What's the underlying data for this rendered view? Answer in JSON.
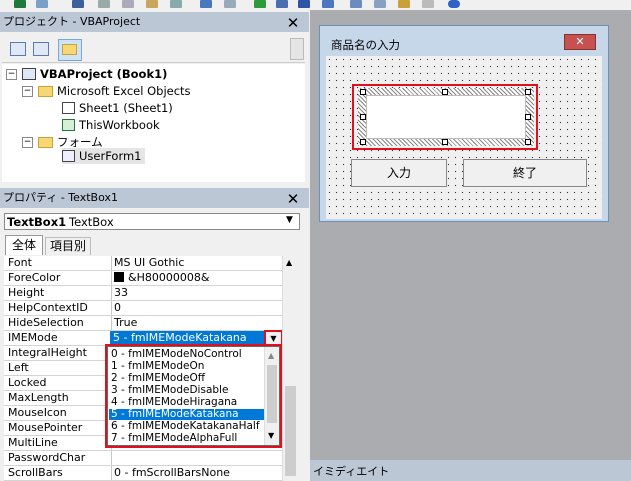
{
  "toolbar": {
    "icons": [
      "excel-icon",
      "insert-icon",
      "save-icon",
      "cut-icon",
      "copy-icon",
      "paste-icon",
      "find-icon",
      "undo-icon",
      "redo-icon",
      "run-icon",
      "break-icon",
      "reset-icon",
      "design-icon",
      "explorer-icon",
      "properties-icon",
      "object-browser-icon",
      "toolbox-icon",
      "help-icon"
    ]
  },
  "project_panel": {
    "title": "プロジェクト - VBAProject",
    "tree": {
      "root": "VBAProject (Book1)",
      "excel_objects": "Microsoft Excel Objects",
      "sheet1": "Sheet1 (Sheet1)",
      "workbook": "ThisWorkbook",
      "forms": "フォーム",
      "userform": "UserForm1"
    }
  },
  "properties_panel": {
    "title": "プロパティ - TextBox1",
    "object_name": "TextBox1",
    "object_type": "TextBox",
    "tabs": [
      "全体",
      "項目別"
    ],
    "rows": [
      {
        "name": "Font",
        "value": "MS UI Gothic"
      },
      {
        "name": "ForeColor",
        "value": "&H80000008&"
      },
      {
        "name": "Height",
        "value": "33"
      },
      {
        "name": "HelpContextID",
        "value": "0"
      },
      {
        "name": "HideSelection",
        "value": "True"
      },
      {
        "name": "IMEMode",
        "value": "5 - fmIMEModeKatakana"
      },
      {
        "name": "IntegralHeight",
        "value": ""
      },
      {
        "name": "Left",
        "value": ""
      },
      {
        "name": "Locked",
        "value": ""
      },
      {
        "name": "MaxLength",
        "value": ""
      },
      {
        "name": "MouseIcon",
        "value": ""
      },
      {
        "name": "MousePointer",
        "value": ""
      },
      {
        "name": "MultiLine",
        "value": "False"
      },
      {
        "name": "PasswordChar",
        "value": ""
      },
      {
        "name": "ScrollBars",
        "value": "0 - fmScrollBarsNone"
      }
    ],
    "dropdown_options": [
      "0 - fmIMEModeNoControl",
      "1 - fmIMEModeOn",
      "2 - fmIMEModeOff",
      "3 - fmIMEModeDisable",
      "4 - fmIMEModeHiragana",
      "5 - fmIMEModeKatakana",
      "6 - fmIMEModeKatakanaHalf",
      "7 - fmIMEModeAlphaFull"
    ],
    "selected_option_index": 5
  },
  "userform": {
    "caption": "商品名の入力",
    "button_input": "入力",
    "button_end": "終了"
  },
  "immediate": {
    "title": "イミディエイト"
  },
  "colors": {
    "selection": "#0078d7",
    "highlight_border": "#e0101e"
  }
}
